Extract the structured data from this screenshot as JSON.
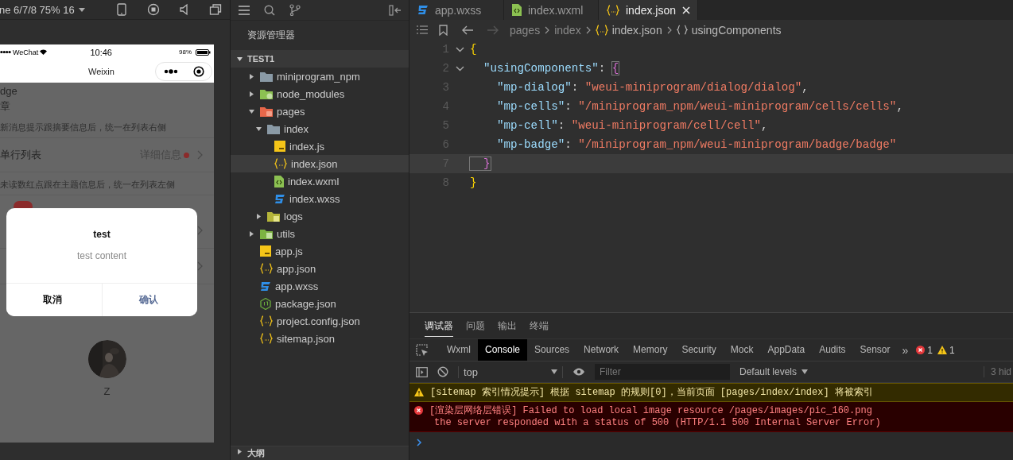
{
  "simulator": {
    "device": "ne 6/7/8 75% 16"
  },
  "phone": {
    "carrier": "WeChat",
    "time": "10:46",
    "battery": "98%",
    "nav_title": "Weixin",
    "heading": "dge",
    "subheading": "章",
    "hint_right": "新消息提示跟摘要信息后，统一在列表右侧",
    "row_title": "单行列表",
    "row_detail": "详细信息",
    "hint_left": "未读数红点跟在主题信息后，统一在列表左侧",
    "dialog": {
      "title": "test",
      "content": "test content",
      "buttons": [
        {
          "label": "取消",
          "kind": "cancel"
        },
        {
          "label": "确认",
          "kind": "confirm"
        }
      ]
    },
    "avatar": {
      "kind": "picture",
      "name": "Z"
    }
  },
  "explorer": {
    "title": "资源管理器",
    "project": {
      "label": "TEST1",
      "expanded": true
    },
    "tree": [
      {
        "label": "miniprogram_npm",
        "kind": "folder",
        "expanded": false,
        "selected": false
      },
      {
        "label": "node_modules",
        "kind": "node",
        "expanded": false,
        "selected": false
      },
      {
        "label": "pages",
        "kind": "pages",
        "expanded": true,
        "selected": false,
        "children": [
          {
            "label": "index",
            "kind": "folder",
            "expanded": true,
            "selected": false,
            "children": [
              {
                "label": "index.js",
                "kind": "js",
                "selected": false
              },
              {
                "label": "index.json",
                "kind": "json",
                "selected": true
              },
              {
                "label": "index.wxml",
                "kind": "wxml",
                "selected": false
              },
              {
                "label": "index.wxss",
                "kind": "wxss",
                "selected": false
              }
            ]
          },
          {
            "label": "logs",
            "kind": "logs",
            "expanded": false,
            "selected": false
          }
        ]
      },
      {
        "label": "utils",
        "kind": "utils",
        "expanded": false,
        "selected": false
      },
      {
        "label": "app.js",
        "kind": "js",
        "selected": false
      },
      {
        "label": "app.json",
        "kind": "json",
        "selected": false
      },
      {
        "label": "app.wxss",
        "kind": "wxss",
        "selected": false
      },
      {
        "label": "package.json",
        "kind": "package",
        "selected": false
      },
      {
        "label": "project.config.json",
        "kind": "json",
        "selected": false
      },
      {
        "label": "sitemap.json",
        "kind": "json",
        "selected": false
      }
    ],
    "outline": {
      "label": "大纲",
      "expanded": false
    }
  },
  "editor": {
    "tabs": [
      {
        "label": "app.wxss",
        "kind": "wxss",
        "selected": false
      },
      {
        "label": "index.wxml",
        "kind": "wxml",
        "selected": false
      },
      {
        "label": "index.json",
        "kind": "json",
        "selected": true
      }
    ],
    "breadcrumb": [
      {
        "label": "pages",
        "kind": "folder"
      },
      {
        "label": "index",
        "kind": "folder"
      },
      {
        "label": "index.json",
        "kind": "json"
      },
      {
        "label": "usingComponents",
        "kind": "object"
      }
    ],
    "lines": [
      {
        "number": "1",
        "foldable": true,
        "selected": false,
        "tokens": [
          {
            "kind": "brace",
            "text": "{"
          }
        ]
      },
      {
        "number": "2",
        "foldable": true,
        "selected": false,
        "tokens": [
          {
            "kind": "key",
            "text": "  \"usingComponents\""
          },
          {
            "kind": "punct",
            "text": ": "
          },
          {
            "kind": "subbrace",
            "text": "{",
            "matched": true
          }
        ]
      },
      {
        "number": "3",
        "foldable": false,
        "selected": false,
        "tokens": [
          {
            "kind": "key",
            "text": "    \"mp-dialog\""
          },
          {
            "kind": "punct",
            "text": ": "
          },
          {
            "kind": "string",
            "text": "\"weui-miniprogram/dialog/dialog\""
          },
          {
            "kind": "punct",
            "text": ","
          }
        ]
      },
      {
        "number": "4",
        "foldable": false,
        "selected": false,
        "tokens": [
          {
            "kind": "key",
            "text": "    \"mp-cells\""
          },
          {
            "kind": "punct",
            "text": ": "
          },
          {
            "kind": "string",
            "text": "\"/miniprogram_npm/weui-miniprogram/cells/cells\""
          },
          {
            "kind": "punct",
            "text": ","
          }
        ]
      },
      {
        "number": "5",
        "foldable": false,
        "selected": false,
        "tokens": [
          {
            "kind": "key",
            "text": "    \"mp-cell\""
          },
          {
            "kind": "punct",
            "text": ": "
          },
          {
            "kind": "string",
            "text": "\"weui-miniprogram/cell/cell\""
          },
          {
            "kind": "punct",
            "text": ","
          }
        ]
      },
      {
        "number": "6",
        "foldable": false,
        "selected": false,
        "tokens": [
          {
            "kind": "key",
            "text": "    \"mp-badge\""
          },
          {
            "kind": "punct",
            "text": ": "
          },
          {
            "kind": "string",
            "text": "\"/miniprogram_npm/weui-miniprogram/badge/badge\""
          }
        ]
      },
      {
        "number": "7",
        "foldable": false,
        "selected": true,
        "tokens": [
          {
            "kind": "subbrace",
            "text": "  }",
            "matched": true
          }
        ]
      },
      {
        "number": "8",
        "foldable": false,
        "selected": false,
        "tokens": [
          {
            "kind": "brace",
            "text": "}"
          }
        ]
      }
    ]
  },
  "panel": {
    "tabs": [
      {
        "label": "调试器",
        "selected": true
      },
      {
        "label": "问题",
        "selected": false
      },
      {
        "label": "输出",
        "selected": false
      },
      {
        "label": "终端",
        "selected": false
      }
    ],
    "devtools_tabs": [
      {
        "label": "Wxml",
        "selected": false
      },
      {
        "label": "Console",
        "selected": true
      },
      {
        "label": "Sources",
        "selected": false
      },
      {
        "label": "Network",
        "selected": false
      },
      {
        "label": "Memory",
        "selected": false
      },
      {
        "label": "Security",
        "selected": false
      },
      {
        "label": "Mock",
        "selected": false
      },
      {
        "label": "AppData",
        "selected": false
      },
      {
        "label": "Audits",
        "selected": false
      },
      {
        "label": "Sensor",
        "selected": false
      }
    ],
    "more": "»",
    "error_count": "1",
    "warning_count": "1",
    "context": "top",
    "filter_placeholder": "Filter",
    "levels": "Default levels",
    "hidden": "3 hid",
    "messages": [
      {
        "kind": "warning",
        "lines": [
          "[sitemap 索引情况提示] 根据 sitemap 的规则[0]，当前页面 [pages/index/index] 将被索引"
        ]
      },
      {
        "kind": "error",
        "lines": [
          "[渲染层网络层错误] Failed to load local image resource /pages/images/pic_160.png",
          "the server responded with a status of 500 (HTTP/1.1 500 Internal Server Error)"
        ]
      }
    ]
  }
}
